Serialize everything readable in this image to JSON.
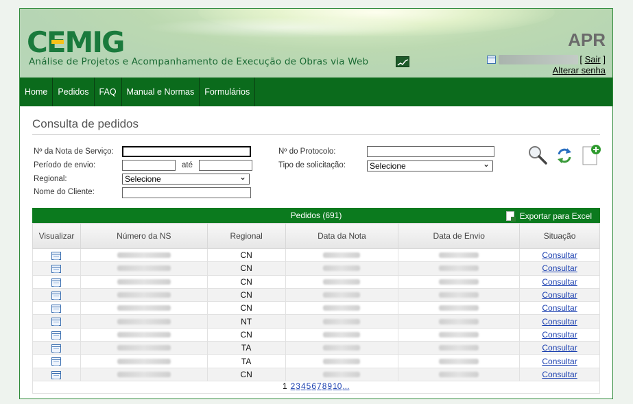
{
  "header": {
    "logo_text": "CEMIG",
    "subtitle": "Análise de Projetos e Acompanhamento de Execução de Obras via Web",
    "app_code": "APR",
    "logout_open": "[",
    "logout_label": "Sair",
    "logout_close": "]",
    "change_password": "Alterar senha"
  },
  "nav": [
    "Home",
    "Pedidos",
    "FAQ",
    "Manual e Normas",
    "Formulários"
  ],
  "page_title": "Consulta de pedidos",
  "form": {
    "ns_label": "Nº da Nota de Serviço:",
    "period_label": "Período de envio:",
    "period_sep": "até",
    "regional_label": "Regional:",
    "regional_value": "Selecione",
    "client_label": "Nome do Cliente:",
    "protocol_label": "Nº do Protocolo:",
    "request_type_label": "Tipo de solicitação:",
    "request_type_value": "Selecione"
  },
  "grid": {
    "caption": "Pedidos (691)",
    "export_label": "Exportar para Excel",
    "columns": [
      "Visualizar",
      "Número da NS",
      "Regional",
      "Data da Nota",
      "Data de Envio",
      "Situação"
    ],
    "rows": [
      {
        "regional": "CN",
        "action": "Consultar"
      },
      {
        "regional": "CN",
        "action": "Consultar"
      },
      {
        "regional": "CN",
        "action": "Consultar"
      },
      {
        "regional": "CN",
        "action": "Consultar"
      },
      {
        "regional": "CN",
        "action": "Consultar"
      },
      {
        "regional": "NT",
        "action": "Consultar"
      },
      {
        "regional": "CN",
        "action": "Consultar"
      },
      {
        "regional": "TA",
        "action": "Consultar"
      },
      {
        "regional": "TA",
        "action": "Consultar"
      },
      {
        "regional": "CN",
        "action": "Consultar"
      }
    ],
    "pager": {
      "current": "1",
      "pages": [
        "2",
        "3",
        "4",
        "5",
        "6",
        "7",
        "8",
        "9",
        "10",
        "..."
      ]
    }
  },
  "colors": {
    "nav_bg": "#0b6b1c",
    "grid_header_bg": "#0b7a1e",
    "link": "#1a3fb0",
    "brand_green": "#1a7a3c",
    "brand_yellow": "#f7c21a"
  },
  "icons": [
    "user-card-icon",
    "chart-icon",
    "search-icon",
    "refresh-icon",
    "new-document-icon",
    "excel-icon",
    "view-icon"
  ]
}
